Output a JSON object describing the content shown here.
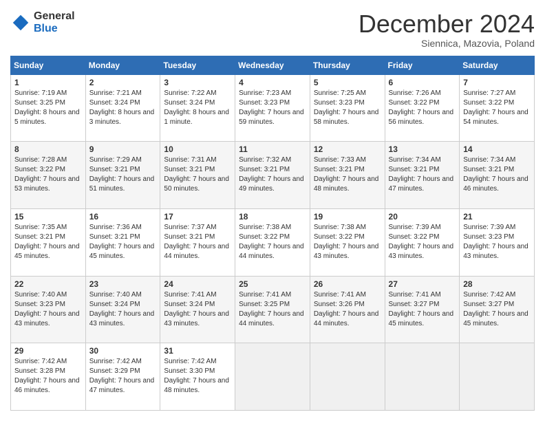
{
  "logo": {
    "general": "General",
    "blue": "Blue"
  },
  "header": {
    "month": "December 2024",
    "location": "Siennica, Mazovia, Poland"
  },
  "days_of_week": [
    "Sunday",
    "Monday",
    "Tuesday",
    "Wednesday",
    "Thursday",
    "Friday",
    "Saturday"
  ],
  "weeks": [
    [
      {
        "day": 1,
        "sunrise": "7:19 AM",
        "sunset": "3:25 PM",
        "daylight": "8 hours and 5 minutes."
      },
      {
        "day": 2,
        "sunrise": "7:21 AM",
        "sunset": "3:24 PM",
        "daylight": "8 hours and 3 minutes."
      },
      {
        "day": 3,
        "sunrise": "7:22 AM",
        "sunset": "3:24 PM",
        "daylight": "8 hours and 1 minute."
      },
      {
        "day": 4,
        "sunrise": "7:23 AM",
        "sunset": "3:23 PM",
        "daylight": "7 hours and 59 minutes."
      },
      {
        "day": 5,
        "sunrise": "7:25 AM",
        "sunset": "3:23 PM",
        "daylight": "7 hours and 58 minutes."
      },
      {
        "day": 6,
        "sunrise": "7:26 AM",
        "sunset": "3:22 PM",
        "daylight": "7 hours and 56 minutes."
      },
      {
        "day": 7,
        "sunrise": "7:27 AM",
        "sunset": "3:22 PM",
        "daylight": "7 hours and 54 minutes."
      }
    ],
    [
      {
        "day": 8,
        "sunrise": "7:28 AM",
        "sunset": "3:22 PM",
        "daylight": "7 hours and 53 minutes."
      },
      {
        "day": 9,
        "sunrise": "7:29 AM",
        "sunset": "3:21 PM",
        "daylight": "7 hours and 51 minutes."
      },
      {
        "day": 10,
        "sunrise": "7:31 AM",
        "sunset": "3:21 PM",
        "daylight": "7 hours and 50 minutes."
      },
      {
        "day": 11,
        "sunrise": "7:32 AM",
        "sunset": "3:21 PM",
        "daylight": "7 hours and 49 minutes."
      },
      {
        "day": 12,
        "sunrise": "7:33 AM",
        "sunset": "3:21 PM",
        "daylight": "7 hours and 48 minutes."
      },
      {
        "day": 13,
        "sunrise": "7:34 AM",
        "sunset": "3:21 PM",
        "daylight": "7 hours and 47 minutes."
      },
      {
        "day": 14,
        "sunrise": "7:34 AM",
        "sunset": "3:21 PM",
        "daylight": "7 hours and 46 minutes."
      }
    ],
    [
      {
        "day": 15,
        "sunrise": "7:35 AM",
        "sunset": "3:21 PM",
        "daylight": "7 hours and 45 minutes."
      },
      {
        "day": 16,
        "sunrise": "7:36 AM",
        "sunset": "3:21 PM",
        "daylight": "7 hours and 45 minutes."
      },
      {
        "day": 17,
        "sunrise": "7:37 AM",
        "sunset": "3:21 PM",
        "daylight": "7 hours and 44 minutes."
      },
      {
        "day": 18,
        "sunrise": "7:38 AM",
        "sunset": "3:22 PM",
        "daylight": "7 hours and 44 minutes."
      },
      {
        "day": 19,
        "sunrise": "7:38 AM",
        "sunset": "3:22 PM",
        "daylight": "7 hours and 43 minutes."
      },
      {
        "day": 20,
        "sunrise": "7:39 AM",
        "sunset": "3:22 PM",
        "daylight": "7 hours and 43 minutes."
      },
      {
        "day": 21,
        "sunrise": "7:39 AM",
        "sunset": "3:23 PM",
        "daylight": "7 hours and 43 minutes."
      }
    ],
    [
      {
        "day": 22,
        "sunrise": "7:40 AM",
        "sunset": "3:23 PM",
        "daylight": "7 hours and 43 minutes."
      },
      {
        "day": 23,
        "sunrise": "7:40 AM",
        "sunset": "3:24 PM",
        "daylight": "7 hours and 43 minutes."
      },
      {
        "day": 24,
        "sunrise": "7:41 AM",
        "sunset": "3:24 PM",
        "daylight": "7 hours and 43 minutes."
      },
      {
        "day": 25,
        "sunrise": "7:41 AM",
        "sunset": "3:25 PM",
        "daylight": "7 hours and 44 minutes."
      },
      {
        "day": 26,
        "sunrise": "7:41 AM",
        "sunset": "3:26 PM",
        "daylight": "7 hours and 44 minutes."
      },
      {
        "day": 27,
        "sunrise": "7:41 AM",
        "sunset": "3:27 PM",
        "daylight": "7 hours and 45 minutes."
      },
      {
        "day": 28,
        "sunrise": "7:42 AM",
        "sunset": "3:27 PM",
        "daylight": "7 hours and 45 minutes."
      }
    ],
    [
      {
        "day": 29,
        "sunrise": "7:42 AM",
        "sunset": "3:28 PM",
        "daylight": "7 hours and 46 minutes."
      },
      {
        "day": 30,
        "sunrise": "7:42 AM",
        "sunset": "3:29 PM",
        "daylight": "7 hours and 47 minutes."
      },
      {
        "day": 31,
        "sunrise": "7:42 AM",
        "sunset": "3:30 PM",
        "daylight": "7 hours and 48 minutes."
      },
      null,
      null,
      null,
      null
    ]
  ]
}
